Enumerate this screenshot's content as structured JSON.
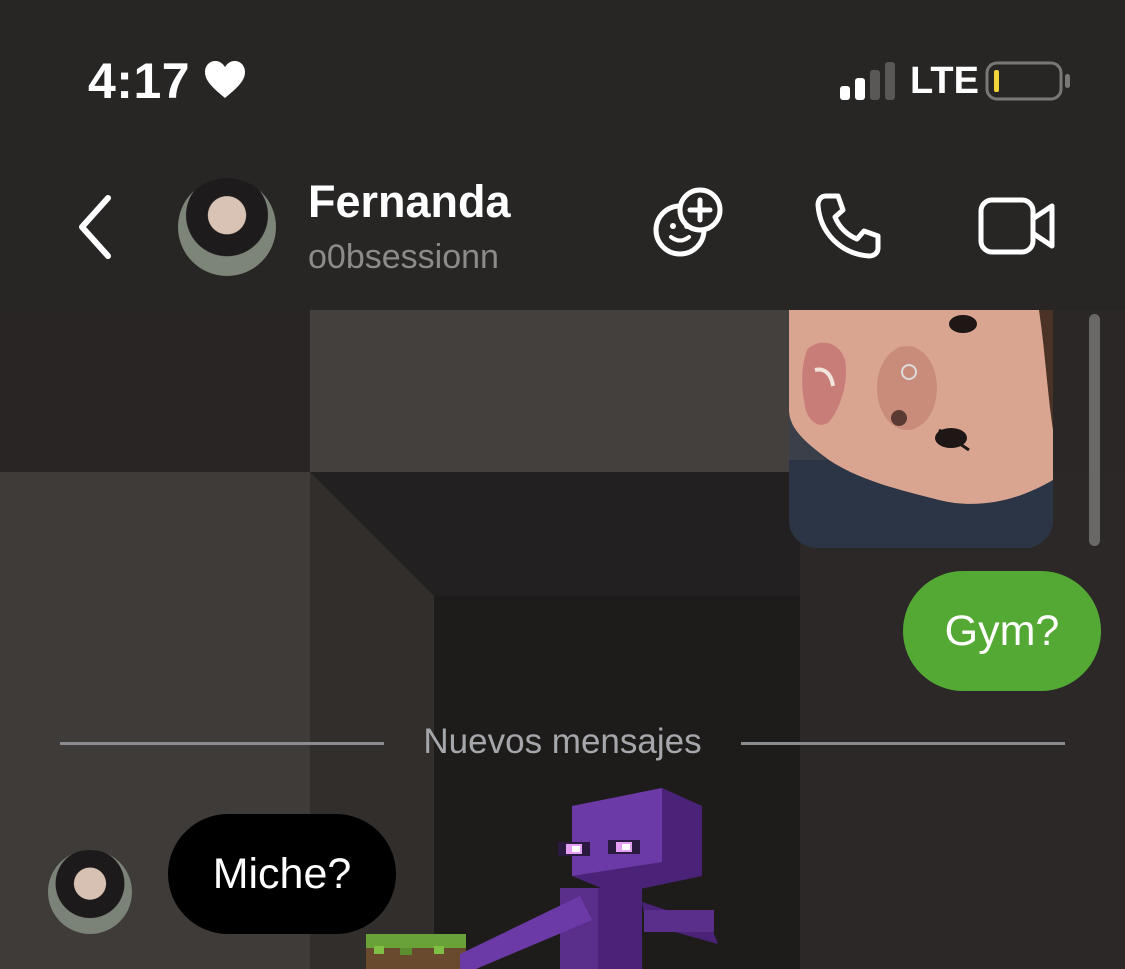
{
  "status_bar": {
    "time": "4:17",
    "network": "LTE",
    "signal_bars_active": 2,
    "signal_bars_total": 4,
    "battery_color": "#f1d33a"
  },
  "header": {
    "contact_name": "Fernanda",
    "contact_username": "o0bsessionn"
  },
  "messages": {
    "outgoing_text": "Gym?",
    "outgoing_color": "#54a935",
    "divider_label": "Nuevos mensajes",
    "incoming_text": "Miche?",
    "incoming_color": "#000000"
  },
  "icons": [
    "heart-icon",
    "signal-icon",
    "battery-icon",
    "back-icon",
    "effects-icon",
    "phone-icon",
    "video-icon"
  ]
}
